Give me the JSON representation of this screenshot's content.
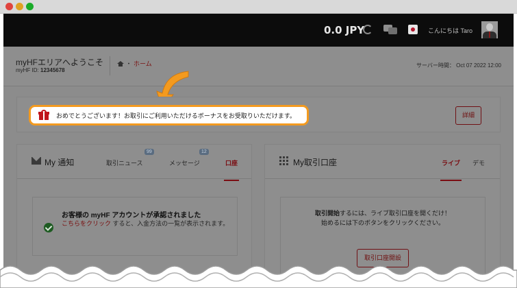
{
  "topbar": {
    "balance": "0.0 JPY",
    "greeting": "こんにちは Taro",
    "icons": [
      "refresh-icon",
      "chat-icon",
      "flag-icon",
      "avatar"
    ]
  },
  "welcome": {
    "title": "myHFエリアへようこそ",
    "id_label": "myHF ID:",
    "id_value": "12345678",
    "breadcrumb_sep": "・",
    "breadcrumb_home": "ホーム",
    "server_time": "サーバー時間： Oct 07 2022 12:00"
  },
  "bonus": {
    "message": "おめでとうございます！お取引にご利用いただけるボーナスをお受取りいただけます。",
    "detail_label": "詳細"
  },
  "notifications": {
    "title": "My 通知",
    "tabs": [
      {
        "label": "取引ニュース",
        "badge": "99"
      },
      {
        "label": "メッセージ",
        "badge": "12"
      },
      {
        "label": "口座",
        "badge": ""
      }
    ],
    "card": {
      "title": "お客様の myHF アカウントが承認されました",
      "link": "こちらをクリック",
      "body": "すると、入金方法の一覧が表示されます。"
    }
  },
  "accounts": {
    "title": "My取引口座",
    "tabs": [
      {
        "label": "ライブ"
      },
      {
        "label": "デモ"
      }
    ],
    "card": {
      "text_bold": "取引開始",
      "text_line1": "するには、ライブ取引口座を開くだけ！",
      "text_line2": "始めるには下のボタンをクリックください。",
      "button": "取引口座開設"
    }
  },
  "colors": {
    "highlight": "#f39a1f",
    "accent": "#7a0d12",
    "success": "#1e5b22"
  }
}
